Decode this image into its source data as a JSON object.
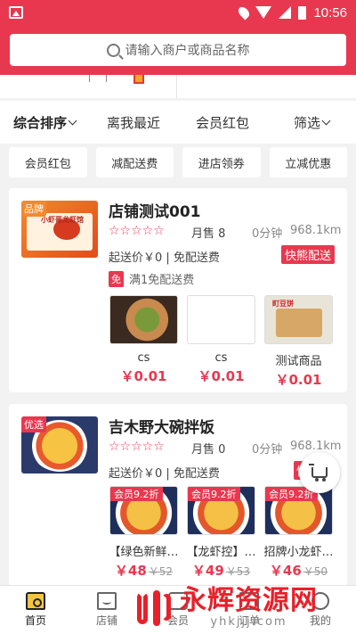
{
  "status_bar": {
    "time": "10:56"
  },
  "search": {
    "placeholder": "请输入商户或商品名称"
  },
  "sort_bar": {
    "items": [
      {
        "label": "综合排序",
        "has_chevron": true,
        "active": true
      },
      {
        "label": "离我最近",
        "has_chevron": false,
        "active": false
      },
      {
        "label": "会员红包",
        "has_chevron": false,
        "active": false
      },
      {
        "label": "筛选",
        "has_chevron": true,
        "active": false
      }
    ]
  },
  "filter_chips": [
    "会员红包",
    "减配送费",
    "进店领券",
    "立减优惠"
  ],
  "shops": [
    {
      "tag": "品牌",
      "thumb_text": "小虾哥龙虾馆",
      "name": "店铺测试001",
      "stars": "☆☆☆☆☆",
      "monthly_sales": "月售 8",
      "time": "0分钟",
      "distance": "968.1km",
      "min_order": "起送价￥0 | 免配送费",
      "delivery_badge": "快熊配送",
      "promo_badge": "免",
      "promo_text": "满1免配送费",
      "products": [
        {
          "name": "cs",
          "price": "￥0.01"
        },
        {
          "name": "cs",
          "price": "￥0.01"
        },
        {
          "name": "测试商品",
          "price": "￥0.01",
          "label": "町豆饼"
        }
      ]
    },
    {
      "tag": "优选",
      "name": "吉木野大碗拌饭",
      "stars": "☆☆☆☆☆",
      "monthly_sales": "月售 0",
      "time": "0分钟",
      "distance": "968.1km",
      "min_order": "起送价￥0 | 免配送费",
      "delivery_badge": "快熊配送",
      "products": [
        {
          "vip": "会员9.2折",
          "name": "【绿色新鲜…",
          "price": "￥48",
          "old_price": "￥52"
        },
        {
          "vip": "会员9.2折",
          "name": "【龙虾控】…",
          "price": "￥49",
          "old_price": "￥53"
        },
        {
          "vip": "会员9.2折",
          "name": "招牌小龙虾…",
          "price": "￥46",
          "old_price": "￥50"
        }
      ]
    }
  ],
  "bottom_nav": [
    {
      "label": "首页",
      "icon": "home-icon",
      "active": true
    },
    {
      "label": "店铺",
      "icon": "store-icon",
      "active": false
    },
    {
      "label": "会员",
      "icon": "member-icon",
      "active": false
    },
    {
      "label": "订单",
      "icon": "order-icon",
      "active": false
    },
    {
      "label": "我的",
      "icon": "profile-icon",
      "active": false
    }
  ],
  "watermark": {
    "title": "永辉资源网",
    "url": "yhkjjj.com"
  },
  "colors": {
    "accent": "#e8384f",
    "background": "#f2f2f2"
  }
}
